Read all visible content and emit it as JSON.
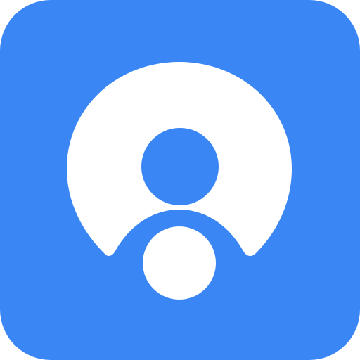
{
  "icon": {
    "name": "user-avatar-app-icon",
    "colors": {
      "background": "#3A86F5",
      "foreground": "#FFFFFF"
    }
  }
}
